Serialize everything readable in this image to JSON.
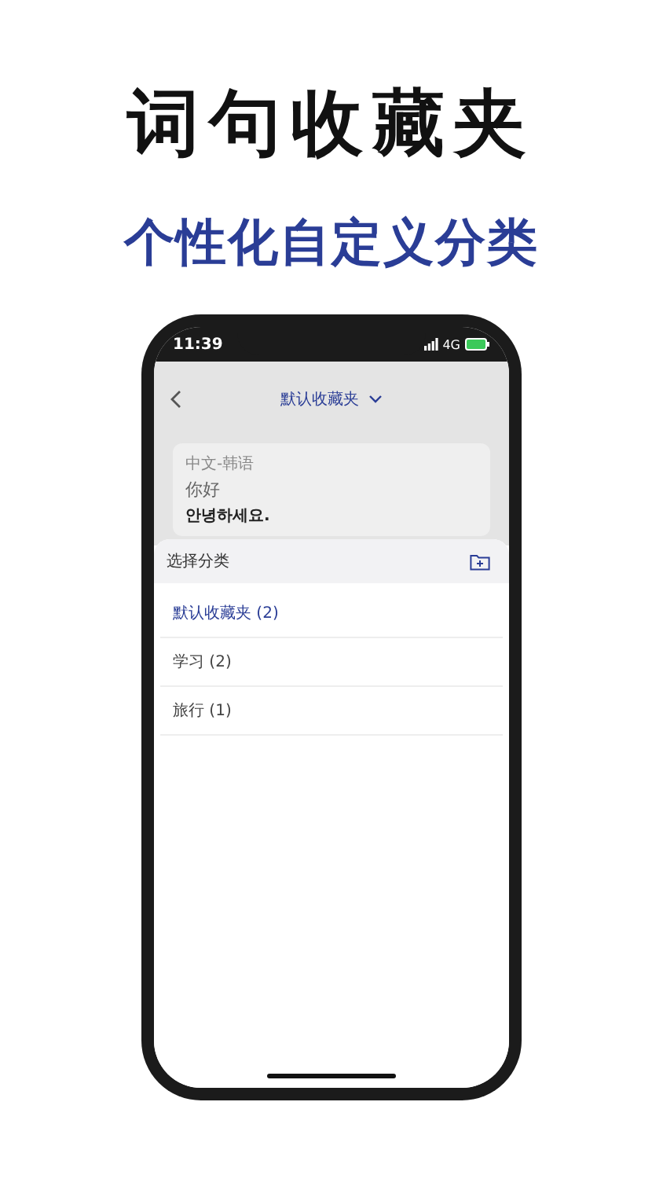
{
  "headline": "词句收藏夹",
  "subheadline": "个性化自定义分类",
  "status_bar": {
    "time": "11:39",
    "network": "4G"
  },
  "nav": {
    "title": "默认收藏夹"
  },
  "card": {
    "language_pair": "中文-韩语",
    "source": "你好",
    "translation": "안녕하세요."
  },
  "sheet": {
    "title": "选择分类",
    "items": [
      {
        "label": "默认收藏夹 (2)",
        "selected": true
      },
      {
        "label": "学习 (2)",
        "selected": false
      },
      {
        "label": "旅行 (1)",
        "selected": false
      }
    ]
  }
}
